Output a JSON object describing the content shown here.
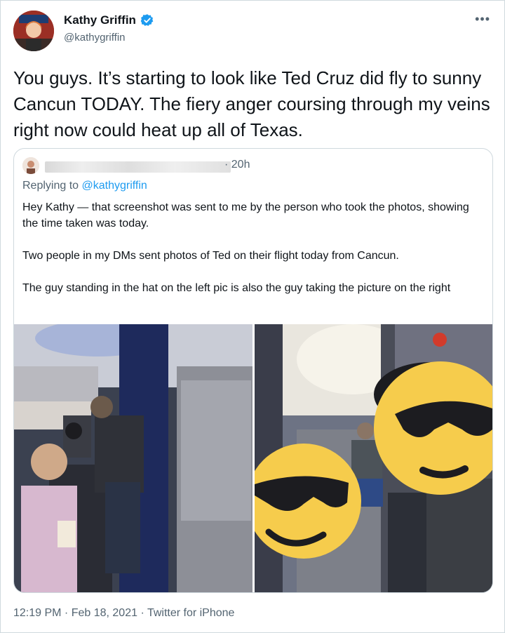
{
  "author": {
    "name": "Kathy Griffin",
    "handle": "@kathygriffin"
  },
  "menu": {
    "more_label": "•••"
  },
  "tweet": {
    "text": "You guys. It’s starting to look like Ted Cruz did fly to sunny Cancun TODAY. The fiery anger coursing through my veins right now could heat up all of Texas."
  },
  "quoted": {
    "time": "· 20h",
    "replying_prefix": "Replying to ",
    "replying_to": "@kathygriffin",
    "paragraphs": [
      "Hey Kathy — that screenshot was sent to me by the person who took the photos, showing the time taken was today.",
      "Two people in my DMs sent photos of Ted on their flight today from Cancun.",
      "The guy standing in the hat on the left pic is also the guy taking the picture on the right"
    ]
  },
  "footer": {
    "time": "12:19 PM",
    "sep1": " · ",
    "date": "Feb 18, 2021",
    "sep2": " · ",
    "source": "Twitter for iPhone"
  },
  "colors": {
    "verified": "#1d9bf0",
    "link": "#1d9bf0",
    "secondary_text": "#536471",
    "border": "#cfd9de"
  },
  "icons": [
    "verified-badge-icon",
    "more-options-icon",
    "sunglasses-emoji-icon"
  ]
}
